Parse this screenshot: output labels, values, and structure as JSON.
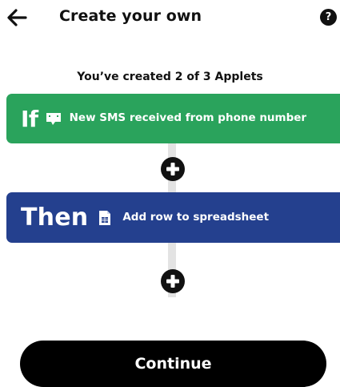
{
  "header": {
    "title": "Create your own",
    "back_icon": "arrow-left-icon",
    "help_icon": "question-mark-icon",
    "help_glyph": "?"
  },
  "applet_count_text": "You’ve created 2 of 3 Applets",
  "trigger": {
    "keyword": "If",
    "text": "New SMS received from phone number",
    "service_icon": "sms-message-icon",
    "color": "#2aa35c"
  },
  "action": {
    "keyword": "Then",
    "text": "Add row to spreadsheet",
    "service_icon": "spreadsheet-icon",
    "color": "#24408e"
  },
  "plus_icon": "plus-circle-icon",
  "continue_label": "Continue",
  "colors": {
    "background": "#ffffff",
    "text": "#111111",
    "connector": "#e3e3e3",
    "button": "#000000"
  }
}
